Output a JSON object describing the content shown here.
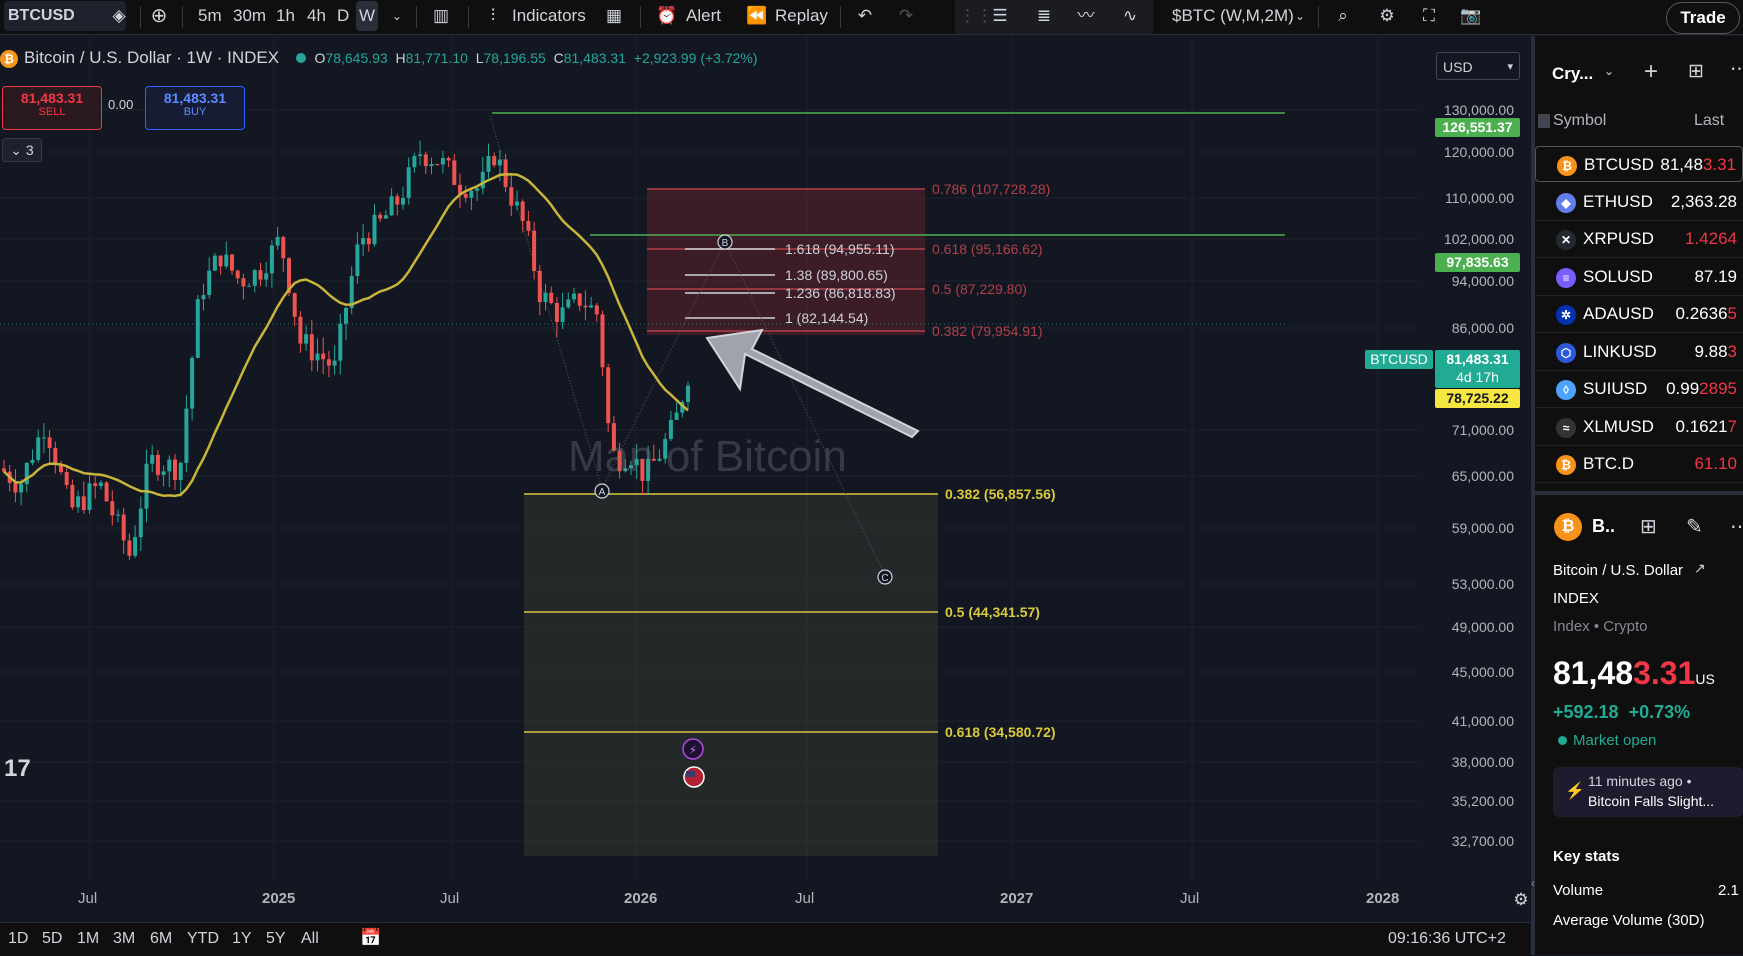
{
  "toolbar": {
    "symbol": "BTCUSD",
    "timeframes": [
      "5m",
      "30m",
      "1h",
      "4h",
      "D",
      "W"
    ],
    "active_timeframe": "W",
    "indicators_label": "Indicators",
    "alert_label": "Alert",
    "replay_label": "Replay",
    "comparison_symbol": "$BTC (W,M,2M)",
    "trade_label": "Trade"
  },
  "legend": {
    "title": "Bitcoin / U.S. Dollar · 1W · INDEX",
    "o_label": "O",
    "o_value": "78,645.93",
    "h_label": "H",
    "h_value": "81,771.10",
    "l_label": "L",
    "l_value": "78,196.55",
    "c_label": "C",
    "c_value": "81,483.31",
    "change": "+2,923.99 (+3.72%)",
    "sell_price": "81,483.31",
    "sell_label": "SELL",
    "spread": "0.00",
    "buy_price": "81,483.31",
    "buy_label": "BUY",
    "collapsed_count": "3",
    "currency": "USD"
  },
  "watermark": "Man of Bitcoin",
  "price_axis": [
    "130,000.00",
    "120,000.00",
    "110,000.00",
    "102,000.00",
    "94,000.00",
    "86,000.00",
    "71,000.00",
    "65,000.00",
    "59,000.00",
    "53,000.00",
    "49,000.00",
    "45,000.00",
    "41,000.00",
    "38,000.00",
    "35,200.00",
    "32,700.00"
  ],
  "price_tags": {
    "high": "126,551.37",
    "resistance": "97,835.63",
    "symbol_tag": "BTCUSD",
    "last": "81,483.31",
    "countdown": "4d 17h",
    "ma": "78,725.22"
  },
  "fib_upper": [
    {
      "label": "0.786 (107,728.28)"
    },
    {
      "label": "0.618 (95,166.62)"
    },
    {
      "label": "0.5 (87,229.80)"
    },
    {
      "label": "0.382 (79,954.91)"
    }
  ],
  "fib_ext": [
    {
      "label": "1.618 (94,955.11)"
    },
    {
      "label": "1.38 (89,800.65)"
    },
    {
      "label": "1.236 (86,818.83)"
    },
    {
      "label": "1 (82,144.54)"
    }
  ],
  "fib_lower": [
    {
      "label": "0.382 (56,857.56)"
    },
    {
      "label": "0.5 (44,341.57)"
    },
    {
      "label": "0.618 (34,580.72)"
    }
  ],
  "wave_labels": [
    "A",
    "B",
    "C"
  ],
  "time_axis": [
    "Jul",
    "2025",
    "Jul",
    "2026",
    "Jul",
    "2027",
    "Jul",
    "2028"
  ],
  "bottom": {
    "ranges": [
      "1D",
      "5D",
      "1M",
      "3M",
      "6M",
      "YTD",
      "1Y",
      "5Y",
      "All"
    ],
    "clock": "09:16:36 UTC+2"
  },
  "watchlist": {
    "title": "Cry...",
    "col_symbol": "Symbol",
    "col_last": "Last",
    "rows": [
      {
        "symbol": "BTCUSD",
        "last_a": "81,48",
        "last_b": "3.31",
        "color": "#f7931a",
        "icon": "₿"
      },
      {
        "symbol": "ETHUSD",
        "last_a": "2,363.28",
        "last_b": "",
        "color": "#627eea",
        "icon": "◆"
      },
      {
        "symbol": "XRPUSD",
        "last_a": "",
        "last_b": "1.4264",
        "color": "#23292f",
        "icon": "✕"
      },
      {
        "symbol": "SOLUSD",
        "last_a": "87.19",
        "last_b": "",
        "color": "#7b5cff",
        "icon": "≡"
      },
      {
        "symbol": "ADAUSD",
        "last_a": "0.2636",
        "last_b": "5",
        "color": "#0033ad",
        "icon": "✲"
      },
      {
        "symbol": "LINKUSD",
        "last_a": "9.88",
        "last_b": "3",
        "color": "#2a5ada",
        "icon": "⬡"
      },
      {
        "symbol": "SUIUSD",
        "last_a": "0.99",
        "last_b": "2895",
        "color": "#4da2ff",
        "icon": "◊"
      },
      {
        "symbol": "XLMUSD",
        "last_a": "0.1621",
        "last_b": "7",
        "color": "#333333",
        "icon": "≈"
      },
      {
        "symbol": "BTC.D",
        "last_a": "",
        "last_b": "61.10",
        "color": "#f7931a",
        "icon": "₿"
      }
    ]
  },
  "details": {
    "short_name": "B..",
    "full_name": "Bitcoin / U.S. Dollar",
    "exchange": "INDEX",
    "category": "Index • Crypto",
    "price_a": "81,48",
    "price_b": "3.31",
    "currency_suffix": "US",
    "change": "+592.18",
    "change_pct": "+0.73%",
    "market_status": "Market open",
    "news_time": "11 minutes ago •",
    "news_headline": "Bitcoin Falls Slight...",
    "key_stats_title": "Key stats",
    "volume_label": "Volume",
    "volume_value": "2.1",
    "avg_volume_label": "Average Volume (30D)"
  }
}
